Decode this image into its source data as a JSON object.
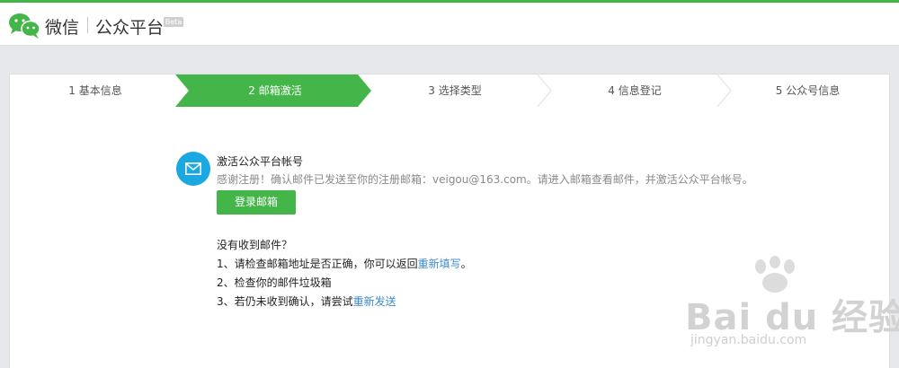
{
  "header": {
    "brand": "微信",
    "platform": "公众平台",
    "badge": "Beta"
  },
  "steps": [
    {
      "label": "1 基本信息",
      "active": false
    },
    {
      "label": "2 邮箱激活",
      "active": true
    },
    {
      "label": "3 选择类型",
      "active": false
    },
    {
      "label": "4 信息登记",
      "active": false
    },
    {
      "label": "5 公众号信息",
      "active": false
    }
  ],
  "activation": {
    "title": "激活公众平台帐号",
    "description": "感谢注册！确认邮件已发送至你的注册邮箱：veigou@163.com。请进入邮箱查看邮件，并激活公众平台帐号。",
    "login_button": "登录邮箱"
  },
  "help": {
    "title": "没有收到邮件？",
    "item1_prefix": "1、请检查邮箱地址是否正确，你可以返回",
    "item1_link": "重新填写",
    "item1_suffix": "。",
    "item2": "2、检查你的邮件垃圾箱",
    "item3_prefix": "3、若仍未收到确认，请尝试",
    "item3_link": "重新发送"
  },
  "watermark": {
    "brand": "Bai du 经验",
    "url": "jingyan.baidu.com"
  },
  "colors": {
    "accent": "#44b549",
    "mail_icon_bg": "#1aa8e0",
    "link": "#3a8bd1"
  }
}
